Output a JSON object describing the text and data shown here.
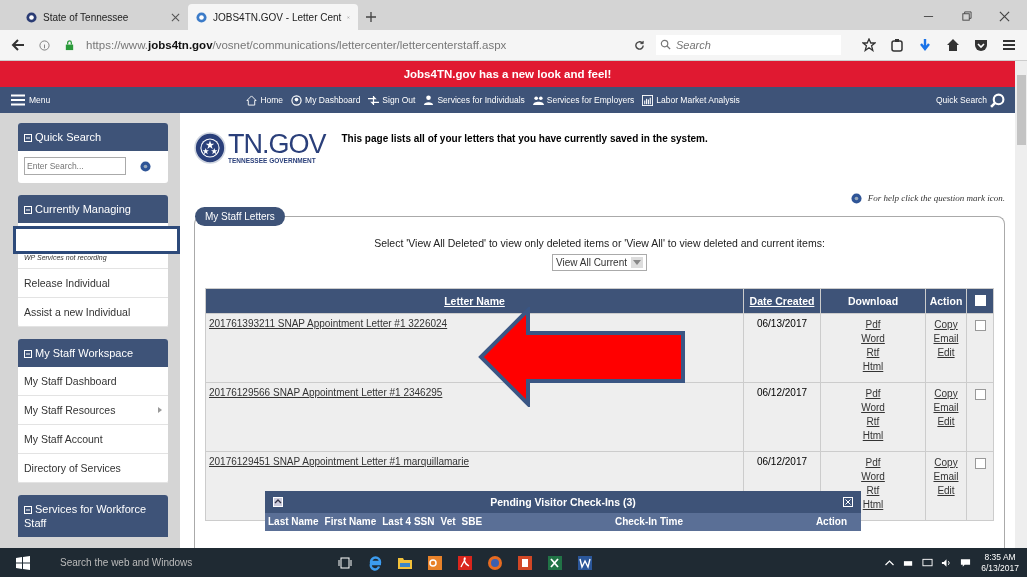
{
  "browser": {
    "tabs": [
      {
        "title": "State of Tennessee",
        "selected": false
      },
      {
        "title": "JOBS4TN.GOV - Letter Cent",
        "selected": true
      }
    ],
    "url": "https://www.**jobs4tn.gov**/vosnet/communications/lettercenter/lettercenterstaff.aspx",
    "search_placeholder": "Search"
  },
  "banner": "Jobs4TN.gov has a new look and feel!",
  "nav": {
    "menu": "Menu",
    "items": [
      {
        "label": "Home"
      },
      {
        "label": "My Dashboard"
      },
      {
        "label": "Sign Out"
      },
      {
        "label": "Services for Individuals"
      },
      {
        "label": "Services for Employers"
      },
      {
        "label": "Labor Market Analysis"
      }
    ],
    "quick_search": "Quick Search"
  },
  "sidebar": {
    "quick_search": {
      "title": "Quick Search",
      "placeholder": "Enter Search..."
    },
    "sections": [
      {
        "title": "Currently Managing",
        "items": [
          {
            "kind": "blank"
          },
          {
            "kind": "note",
            "label": "WP Services not recording"
          },
          {
            "kind": "link",
            "label": "Release Individual",
            "submenu": false
          },
          {
            "kind": "link",
            "label": "Assist a new Individual",
            "submenu": false
          }
        ]
      },
      {
        "title": "My Staff Workspace",
        "items": [
          {
            "kind": "link",
            "label": "My Staff Dashboard",
            "submenu": false
          },
          {
            "kind": "link",
            "label": "My Staff Resources",
            "submenu": true
          },
          {
            "kind": "link",
            "label": "My Staff Account",
            "submenu": false
          },
          {
            "kind": "link",
            "label": "Directory of Services",
            "submenu": false
          }
        ]
      },
      {
        "title": "Services for Workforce Staff"
      }
    ]
  },
  "main": {
    "logo": {
      "name": "TN.GOV",
      "tagline": "TENNESSEE GOVERNMENT"
    },
    "intro": "This page lists all of your letters that you have currently saved in the system.",
    "help": "For help click the question mark icon.",
    "panel": {
      "title": "My Staff Letters",
      "filter_label": "Select 'View All Deleted' to view only deleted items or 'View All' to view deleted and current items:",
      "filter_value": "View All Current"
    },
    "table": {
      "columns": [
        "Letter Name",
        "Date Created",
        "Download",
        "Action"
      ],
      "select_all_checked": false,
      "rows": [
        {
          "name": "201761393211 SNAP Appointment Letter #1 3226024",
          "date": "06/13/2017",
          "downloads": [
            "Pdf",
            "Word",
            "Rtf",
            "Html"
          ],
          "actions": [
            "Copy",
            "Email",
            "Edit"
          ],
          "checked": false
        },
        {
          "name": "20176129566 SNAP Appointment Letter #1 2346295",
          "date": "06/12/2017",
          "downloads": [
            "Pdf",
            "Word",
            "Rtf",
            "Html"
          ],
          "actions": [
            "Copy",
            "Email",
            "Edit"
          ],
          "checked": false
        },
        {
          "name": "20176129451 SNAP Appointment Letter #1 marquillamarie",
          "date": "06/12/2017",
          "downloads": [
            "Pdf",
            "Word",
            "Rtf",
            "Html"
          ],
          "actions": [
            "Copy",
            "Email",
            "Edit"
          ],
          "checked": false
        }
      ]
    }
  },
  "popup": {
    "title": "Pending Visitor Check-Ins (3)",
    "columns": [
      "Last Name",
      "First Name",
      "Last 4 SSN",
      "Vet",
      "SBE",
      "Check-In Time",
      "Action"
    ]
  },
  "taskbar": {
    "search_placeholder": "Search the web and Windows",
    "time": "8:35 AM",
    "date": "6/13/2017"
  }
}
